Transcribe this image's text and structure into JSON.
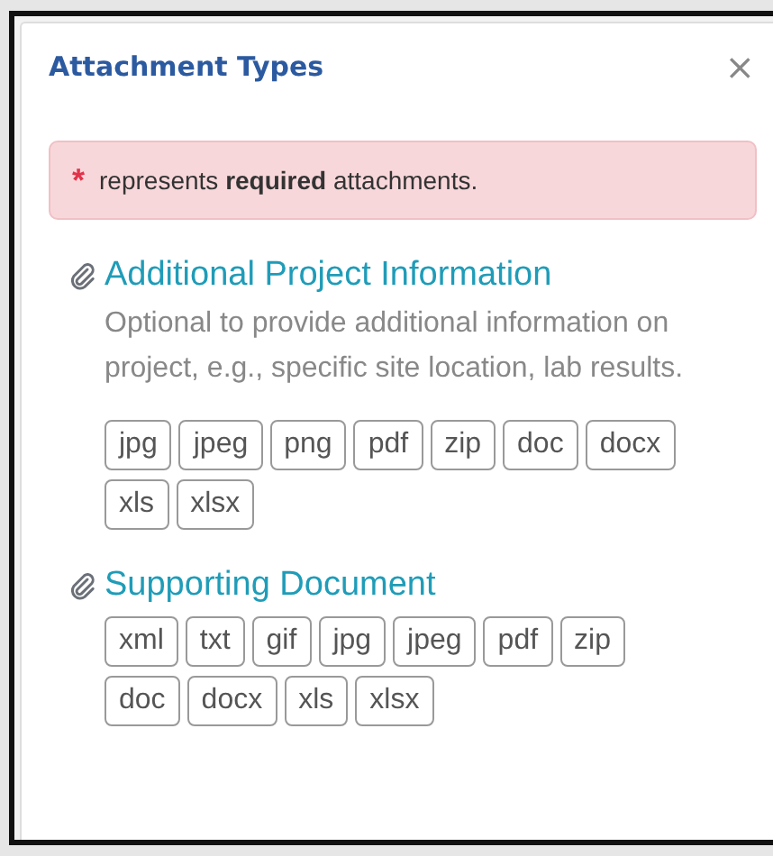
{
  "dialog": {
    "title": "Attachment Types",
    "close": "×"
  },
  "notice": {
    "mark": "*",
    "text": "represents **required** attachments."
  },
  "sections": [
    {
      "title": "Additional Project Information",
      "description": "Optional to provide additional information on project, e.g., specific site location, lab results.",
      "types": [
        "jpg",
        "jpeg",
        "png",
        "pdf",
        "zip",
        "doc",
        "docx",
        "xls",
        "xlsx"
      ]
    },
    {
      "title": "Supporting Document",
      "types": [
        "xml",
        "txt",
        "gif",
        "jpg",
        "jpeg",
        "pdf",
        "zip",
        "doc",
        "docx",
        "xls",
        "xlsx"
      ]
    }
  ]
}
